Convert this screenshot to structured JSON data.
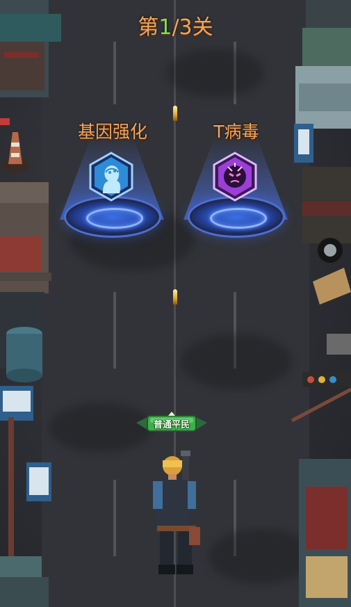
{
  "level": {
    "prefix": "第",
    "current": "1",
    "separator": "/",
    "total": "3",
    "suffix": "关"
  },
  "choices": [
    {
      "label": "基因强化",
      "icon": "brain-head-icon",
      "accent": "#4fb3ff"
    },
    {
      "label": "T病毒",
      "icon": "virus-face-icon",
      "accent": "#c455ff"
    }
  ],
  "player": {
    "title": "普通平民",
    "badge_color": "#3fae4a"
  },
  "colors": {
    "level_text": "#f3a45a",
    "level_current": "#7ee05a",
    "choice_text": "#f4a35a",
    "portal_blue": "#3b6fe0"
  }
}
